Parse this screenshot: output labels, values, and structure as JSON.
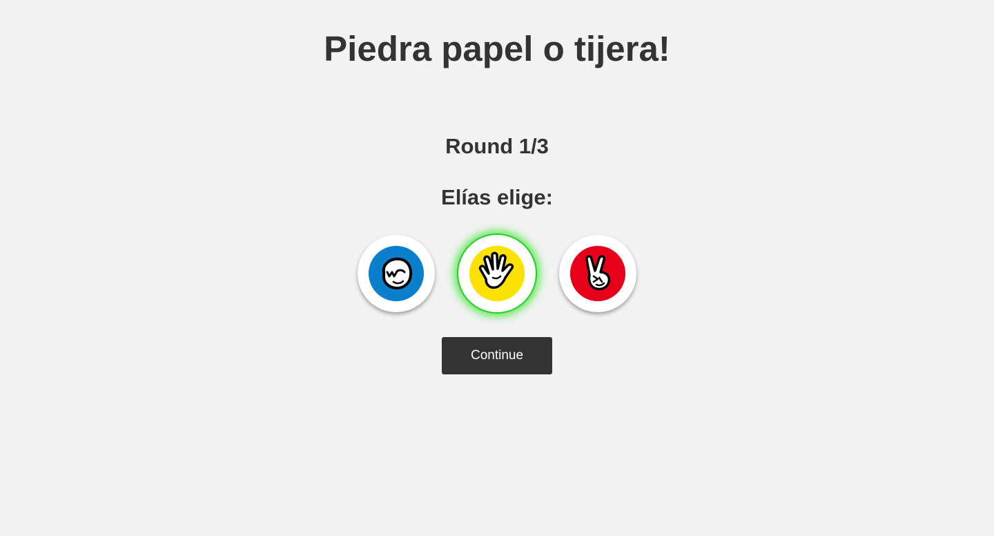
{
  "game": {
    "title": "Piedra papel o tijera!",
    "round_label": "Round 1/3",
    "prompt": "Elías elige:"
  },
  "choices": [
    {
      "name": "rock",
      "icon": "fist-icon",
      "color": "#0a7fcc",
      "selected": false
    },
    {
      "name": "paper",
      "icon": "open-hand-icon",
      "color": "#fbe104",
      "selected": true
    },
    {
      "name": "scissors",
      "icon": "peace-hand-icon",
      "color": "#e6001a",
      "selected": false
    }
  ],
  "colors": {
    "background": "#f2f2f2",
    "text": "#333333",
    "selected_glow": "#22d01e",
    "button": "#333333"
  },
  "actions": {
    "continue_label": "Continue"
  }
}
